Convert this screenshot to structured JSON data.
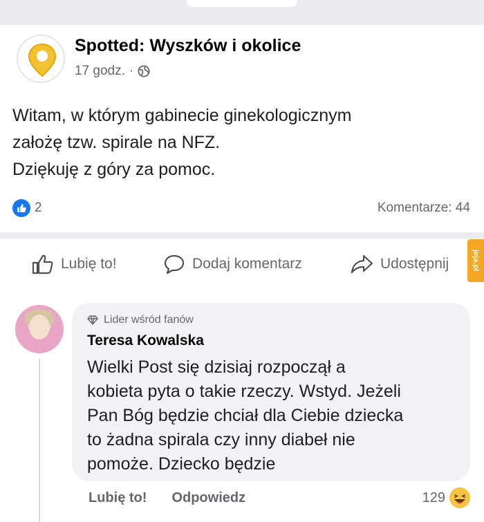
{
  "post": {
    "page_name": "Spotted: Wyszków i okolice",
    "time": "17 godz.",
    "separator": "·",
    "text_lines": [
      "Witam, w którym gabinecie ginekologicznym",
      "założę tzw. spirale na NFZ.",
      "Dziękuję z góry za pomoc."
    ],
    "like_count": "2",
    "comments_count": "Komentarze: 44"
  },
  "actions": {
    "like": "Lubię to!",
    "comment": "Dodaj komentarz",
    "share": "Udostępnij"
  },
  "watermark": "jeja.pl",
  "comment": {
    "badge": "Lider wśród fanów",
    "author": "Teresa Kowalska",
    "text_lines": [
      "Wielki Post się dzisiaj rozpoczął a",
      "kobieta pyta o takie rzeczy. Wstyd. Jeżeli",
      "Pan Bóg będzie chciał dla Ciebie dziecka",
      "to żadna spirala  czy inny diabeł nie",
      "pomoże. Dziecko będzie"
    ],
    "like_label": "Lubię to!",
    "reply_label": "Odpowiedz",
    "reaction_count": "129",
    "reaction_icon": "haha-emoji-icon"
  },
  "colors": {
    "accent": "#1877f2",
    "pin": "#f2c230",
    "watermark": "#f5a623"
  }
}
